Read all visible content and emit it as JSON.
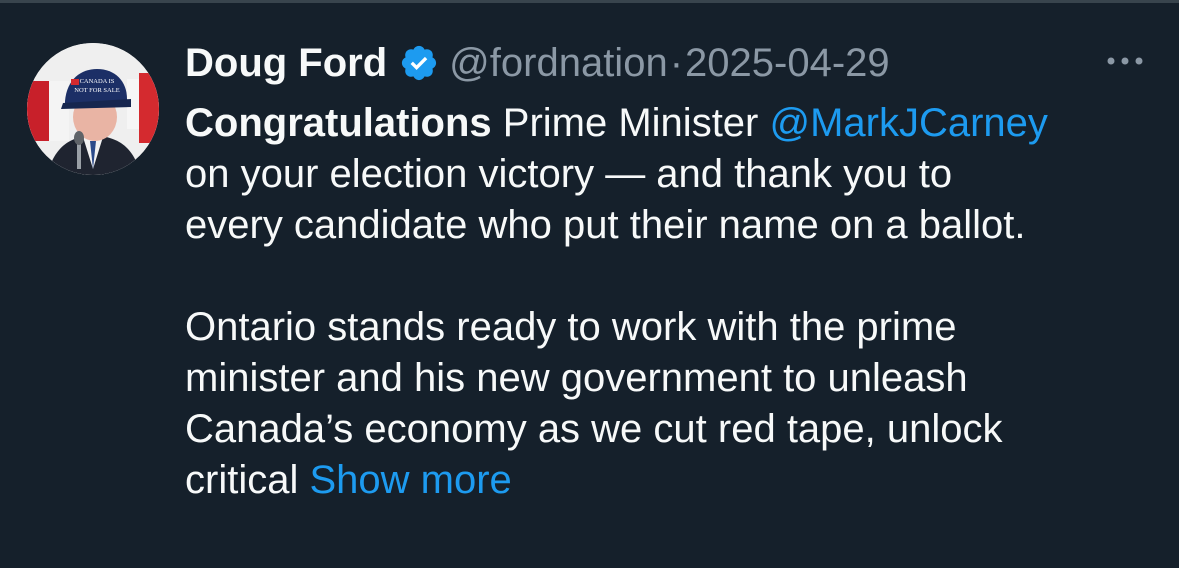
{
  "author": {
    "name": "Doug Ford",
    "handle": "@fordnation",
    "separator": "·",
    "date": "2025-04-29",
    "verified": true,
    "verified_icon": "verified-badge-icon",
    "avatar_cap_text": "CANADA IS NOT FOR SALE"
  },
  "menu": {
    "icon": "more-horizontal-icon"
  },
  "tweet": {
    "line1_bold": "Congratulations",
    "line1_rest": " Prime Minister ",
    "mention": "@MarkJCarney",
    "line2": "on your election victory — and thank you to",
    "line3": "every candidate who put their name on a ballot.",
    "p2_line1": "Ontario stands ready to work with the prime",
    "p2_line2": "minister and his new government to unleash",
    "p2_line3": "Canada’s economy as we cut red tape, unlock",
    "p2_line4": "critical ",
    "show_more": "Show more"
  },
  "colors": {
    "background": "#15202b",
    "text": "#f7f9f9",
    "muted": "#8b98a5",
    "link": "#1d9bf0",
    "verified": "#1d9bf0"
  }
}
